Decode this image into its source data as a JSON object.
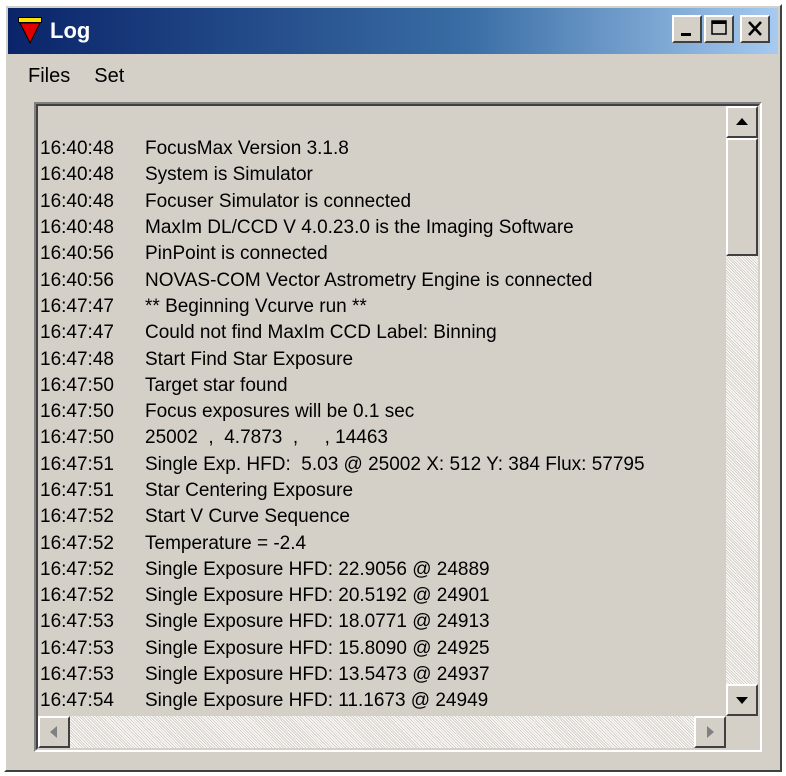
{
  "window": {
    "title": "Log",
    "icon": "focusmax-icon"
  },
  "menu": {
    "items": [
      "Files",
      "Set"
    ]
  },
  "log": {
    "lines": [
      {
        "time": "16:40:48",
        "msg": "FocusMax Version 3.1.8"
      },
      {
        "time": "16:40:48",
        "msg": "System is Simulator"
      },
      {
        "time": "16:40:48",
        "msg": "Focuser Simulator is connected"
      },
      {
        "time": "16:40:48",
        "msg": "MaxIm DL/CCD V 4.0.23.0 is the Imaging Software"
      },
      {
        "time": "16:40:56",
        "msg": "PinPoint is connected"
      },
      {
        "time": "16:40:56",
        "msg": "NOVAS-COM Vector Astrometry Engine is connected"
      },
      {
        "time": "16:47:47",
        "msg": "** Beginning Vcurve run **"
      },
      {
        "time": "16:47:47",
        "msg": "Could not find MaxIm CCD Label: Binning"
      },
      {
        "time": "16:47:48",
        "msg": "Start Find Star Exposure"
      },
      {
        "time": "16:47:50",
        "msg": "Target star found"
      },
      {
        "time": "16:47:50",
        "msg": "Focus exposures will be 0.1 sec"
      },
      {
        "time": "16:47:50",
        "msg": "25002  ,  4.7873  ,     , 14463"
      },
      {
        "time": "16:47:51",
        "msg": "Single Exp. HFD:  5.03 @ 25002 X: 512 Y: 384 Flux: 57795"
      },
      {
        "time": "16:47:51",
        "msg": "Star Centering Exposure"
      },
      {
        "time": "16:47:52",
        "msg": "Start V Curve Sequence"
      },
      {
        "time": "16:47:52",
        "msg": "Temperature = -2.4"
      },
      {
        "time": "16:47:52",
        "msg": "Single Exposure HFD: 22.9056 @ 24889"
      },
      {
        "time": "16:47:52",
        "msg": "Single Exposure HFD: 20.5192 @ 24901"
      },
      {
        "time": "16:47:53",
        "msg": "Single Exposure HFD: 18.0771 @ 24913"
      },
      {
        "time": "16:47:53",
        "msg": "Single Exposure HFD: 15.8090 @ 24925"
      },
      {
        "time": "16:47:53",
        "msg": "Single Exposure HFD: 13.5473 @ 24937"
      },
      {
        "time": "16:47:54",
        "msg": "Single Exposure HFD: 11.1673 @ 24949"
      }
    ]
  },
  "colors": {
    "titlebar_start": "#0a246a",
    "titlebar_end": "#a6caf0",
    "face": "#d4d0c8"
  }
}
